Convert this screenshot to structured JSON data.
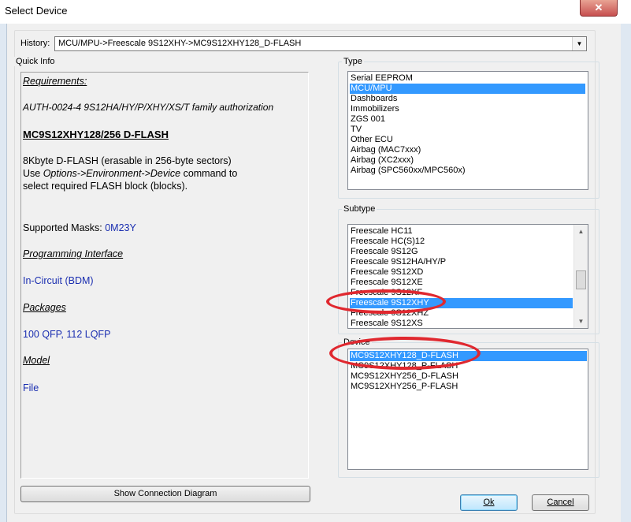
{
  "window": {
    "title": "Select Device",
    "close_glyph": "✕"
  },
  "history": {
    "label": "History:",
    "value": "MCU/MPU->Freescale 9S12XHY->MC9S12XHY128_D-FLASH"
  },
  "quick_info": {
    "label": "Quick Info",
    "requirements_heading": "Requirements:",
    "requirement": "AUTH-0024-4  9S12HA/HY/P/XHY/XS/T family authorization",
    "device_title": "MC9S12XHY128/256 D-FLASH",
    "desc_line1": "8Kbyte D-FLASH (erasable in 256-byte sectors)",
    "desc_line2_pre": "Use ",
    "desc_line2_em": "Options->Environment->Device",
    "desc_line2_post": " command to",
    "desc_line3": "select required FLASH block (blocks).",
    "masks_label": "Supported Masks: ",
    "masks_value": "0M23Y",
    "prog_heading": "Programming Interface",
    "prog_value": "In-Circuit (BDM)",
    "packages_heading": "Packages",
    "packages_value": "100 QFP, 112 LQFP",
    "model_heading": "Model",
    "model_value": "File"
  },
  "type_group": {
    "label": "Type",
    "items": [
      "Serial EEPROM",
      "MCU/MPU",
      "Dashboards",
      "Immobilizers",
      "ZGS 001",
      "TV",
      "Other ECU",
      "Airbag (MAC7xxx)",
      "Airbag (XC2xxx)",
      "Airbag (SPC560xx/MPC560x)"
    ],
    "selected_index": 1
  },
  "subtype_group": {
    "label": "Subtype",
    "items": [
      "Freescale HC11",
      "Freescale HC(S)12",
      "Freescale 9S12G",
      "Freescale 9S12HA/HY/P",
      "Freescale 9S12XD",
      "Freescale 9S12XE",
      "Freescale 9S12XF",
      "Freescale 9S12XHY",
      "Freescale 9S12XHZ",
      "Freescale 9S12XS"
    ],
    "selected_index": 7
  },
  "device_group": {
    "label": "Device",
    "items": [
      "MC9S12XHY128_D-FLASH",
      "MC9S12XHY128_P-FLASH",
      "MC9S12XHY256_D-FLASH",
      "MC9S12XHY256_P-FLASH"
    ],
    "selected_index": 0
  },
  "buttons": {
    "show_diagram": "Show Connection Diagram",
    "ok": "Ok",
    "cancel": "Cancel"
  },
  "icons": {
    "combo_arrow": "▼",
    "scroll_up": "▲",
    "scroll_down": "▼"
  },
  "colors": {
    "selection": "#3399ff",
    "annotation": "#e0282f",
    "link_blue": "#1a2eb0"
  }
}
